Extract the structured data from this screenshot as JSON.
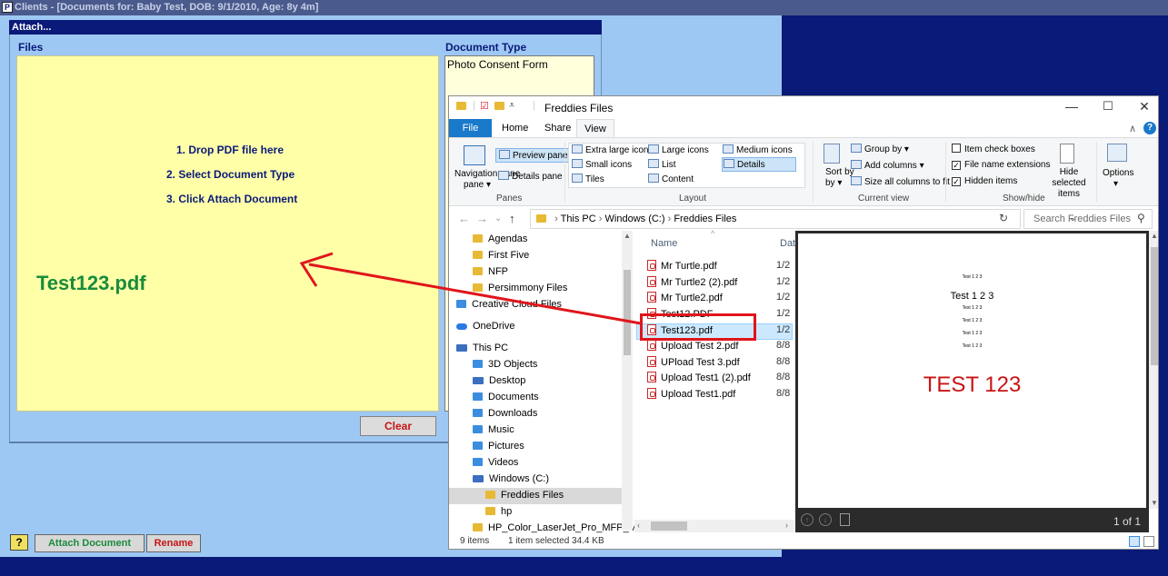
{
  "app": {
    "title": "Clients - [Documents for: Baby Test, DOB: 9/1/2010, Age: 8y 4m]",
    "icon_letter": "P"
  },
  "attach_window": {
    "header": "Attach...",
    "files_label": "Files",
    "document_type_label": "Document Type",
    "instructions": [
      "1. Drop PDF file here",
      "2. Select Document Type",
      "3. Click Attach Document"
    ],
    "dropped_file": "Test123.pdf",
    "document_types": [
      "Photo Consent Form"
    ],
    "clear_button": "Clear",
    "help_button": "?",
    "attach_button": "Attach Document",
    "rename_button": "Rename"
  },
  "explorer": {
    "title": "Freddies Files",
    "window_controls": {
      "minimize": "—",
      "maximize": "☐",
      "close": "✕"
    },
    "tabs": {
      "file": "File",
      "home": "Home",
      "share": "Share",
      "view": "View"
    },
    "ribbon": {
      "panes": {
        "group": "Panes",
        "navigation_pane": "Navigation pane",
        "preview_pane": "Preview pane",
        "details_pane": "Details pane"
      },
      "layout": {
        "group": "Layout",
        "options": [
          "Extra large icons",
          "Large icons",
          "Medium icons",
          "Small icons",
          "List",
          "Details",
          "Tiles",
          "Content"
        ],
        "selected": "Details"
      },
      "current_view": {
        "group": "Current view",
        "sort_by": "Sort by",
        "group_by": "Group by",
        "add_columns": "Add columns",
        "size_all_columns": "Size all columns to fit"
      },
      "show_hide": {
        "group": "Show/hide",
        "item_check_boxes": {
          "label": "Item check boxes",
          "checked": false
        },
        "file_name_extensions": {
          "label": "File name extensions",
          "checked": true
        },
        "hidden_items": {
          "label": "Hidden items",
          "checked": true
        },
        "hide_selected_items": "Hide selected items"
      },
      "options": "Options"
    },
    "address": {
      "crumbs": [
        "This PC",
        "Windows (C:)",
        "Freddies Files"
      ],
      "search_placeholder": "Search Freddies Files"
    },
    "nav_items": [
      {
        "label": "Agendas",
        "icon": "folder-icon"
      },
      {
        "label": "First Five",
        "icon": "folder-icon"
      },
      {
        "label": "NFP",
        "icon": "folder-icon"
      },
      {
        "label": "Persimmony Files",
        "icon": "folder-icon"
      },
      {
        "label": "Creative Cloud Files",
        "icon": "creative-cloud-icon"
      },
      {
        "label": "OneDrive",
        "icon": "onedrive-icon"
      },
      {
        "label": "This PC",
        "icon": "pc-icon"
      },
      {
        "label": "3D Objects",
        "icon": "3d-objects-icon"
      },
      {
        "label": "Desktop",
        "icon": "desktop-icon"
      },
      {
        "label": "Documents",
        "icon": "documents-icon"
      },
      {
        "label": "Downloads",
        "icon": "downloads-icon"
      },
      {
        "label": "Music",
        "icon": "music-icon"
      },
      {
        "label": "Pictures",
        "icon": "pictures-icon"
      },
      {
        "label": "Videos",
        "icon": "videos-icon"
      },
      {
        "label": "Windows (C:)",
        "icon": "drive-icon"
      },
      {
        "label": "Freddies Files",
        "icon": "folder-icon"
      },
      {
        "label": "hp",
        "icon": "folder-icon"
      },
      {
        "label": "HP_Color_LaserJet_Pro_MFP_M",
        "icon": "folder-icon"
      }
    ],
    "columns": {
      "name": "Name",
      "date": "Dat"
    },
    "files": [
      {
        "name": "Mr Turtle.pdf",
        "date": "1/2"
      },
      {
        "name": "Mr Turtle2 (2).pdf",
        "date": "1/2"
      },
      {
        "name": "Mr Turtle2.pdf",
        "date": "1/2"
      },
      {
        "name": "Test12.PDF",
        "date": "1/2"
      },
      {
        "name": "Test123.pdf",
        "date": "1/2"
      },
      {
        "name": "Upload Test 2.pdf",
        "date": "8/8"
      },
      {
        "name": "UPload Test 3.pdf",
        "date": "8/8"
      },
      {
        "name": "Upload Test1 (2).pdf",
        "date": "8/8"
      },
      {
        "name": "Upload Test1.pdf",
        "date": "8/8"
      }
    ],
    "selected_file": "Test123.pdf",
    "preview": {
      "small_line": "Test 1 2 3",
      "mid_line": "Test 1 2 3",
      "big_text": "TEST 123",
      "page_count": "1 of 1"
    },
    "status": {
      "items": "9 items",
      "selection": "1 item selected  34.4 KB"
    }
  },
  "colors": {
    "desktop_bg": "#0a1a78",
    "panel_bg": "#9ec8f4",
    "drop_area": "#ffffa8",
    "dropped_file_text": "#198c3c",
    "annotation_red": "#e0151b"
  }
}
